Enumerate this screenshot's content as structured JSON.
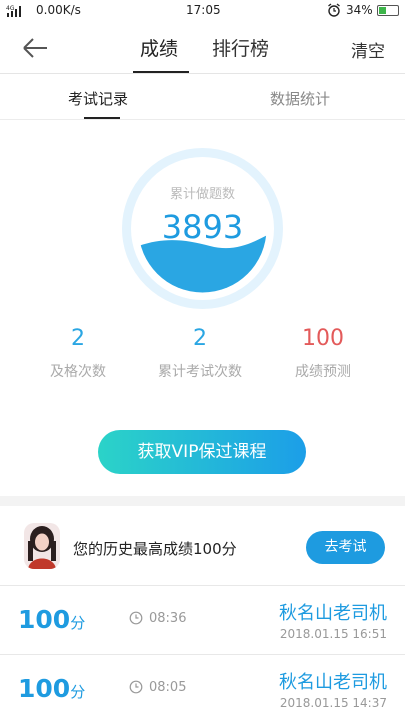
{
  "status_bar": {
    "network_speed": "0.00K/s",
    "time": "17:05",
    "battery": "34%",
    "signal_label": "4G",
    "icons": [
      "signal-icon",
      "alarm-icon",
      "battery-icon"
    ]
  },
  "header": {
    "tabs": [
      {
        "label": "成绩",
        "active": true
      },
      {
        "label": "排行榜",
        "active": false
      }
    ],
    "clear_label": "清空",
    "back_icon": "back-arrow-icon"
  },
  "subtabs": [
    {
      "label": "考试记录",
      "active": true
    },
    {
      "label": "数据统计",
      "active": false
    }
  ],
  "gauge": {
    "label": "累计做题数",
    "value": "3893"
  },
  "stats": [
    {
      "value": "2",
      "label": "及格次数"
    },
    {
      "value": "2",
      "label": "累计考试次数"
    },
    {
      "value": "100",
      "label": "成绩预测"
    }
  ],
  "vip_button": "获取VIP保过课程",
  "best": {
    "text": "您的历史最高成绩100分",
    "button": "去考试"
  },
  "records": [
    {
      "score": "100",
      "unit": "分",
      "duration": "08:36",
      "name": "秋名山老司机",
      "date": "2018.01.15  16:51"
    },
    {
      "score": "100",
      "unit": "分",
      "duration": "08:05",
      "name": "秋名山老司机",
      "date": "2018.01.15  14:37"
    }
  ],
  "colors": {
    "accent": "#1e9be0",
    "predict": "#e35a5a",
    "gradient_start": "#2bd3c8",
    "gradient_end": "#1c9ee8"
  }
}
